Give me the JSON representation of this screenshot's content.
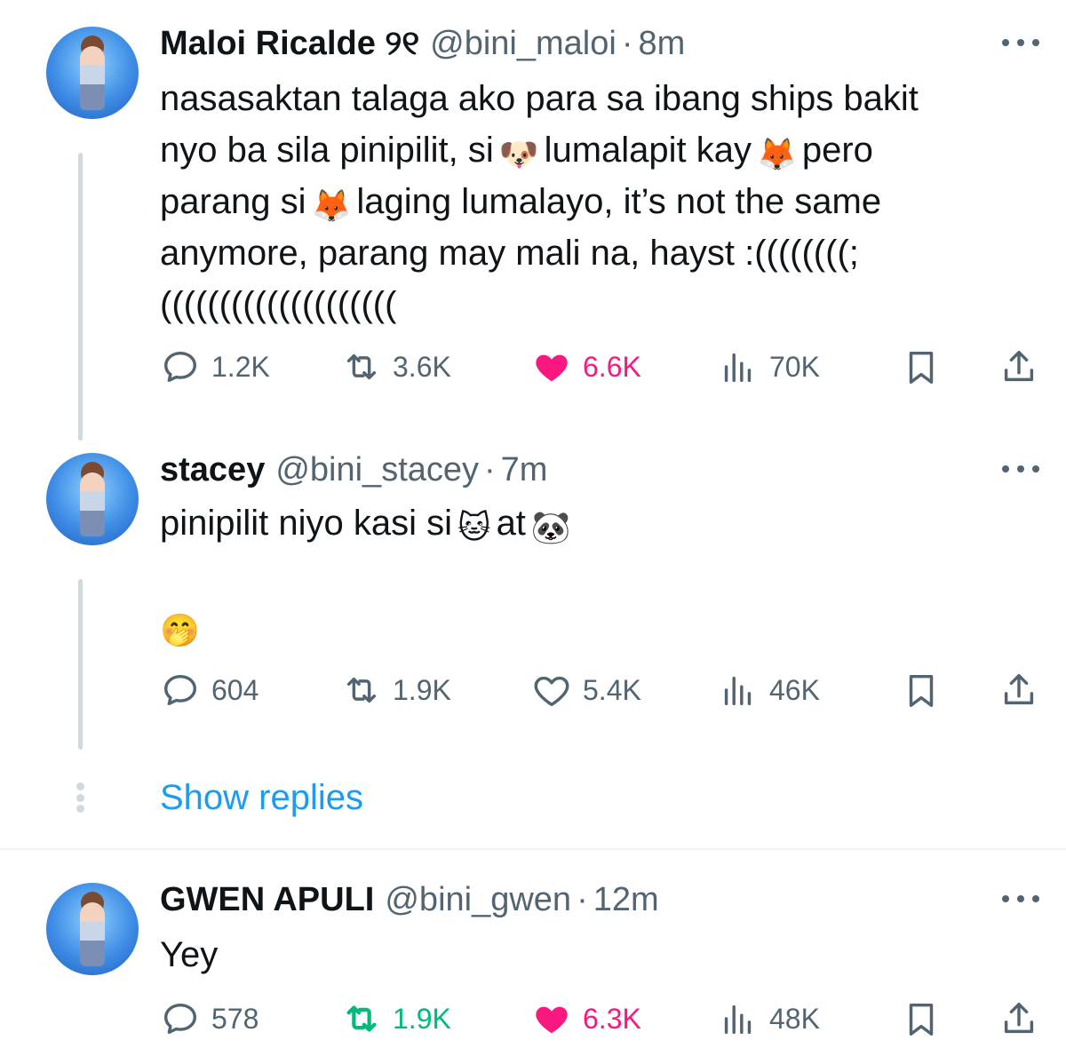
{
  "tweets": [
    {
      "name": "Maloi Ricalde",
      "name_suffix": "୨୧",
      "handle": "@bini_maloi",
      "time": "8m",
      "text_lines": [
        [
          "nasasaktan talaga ako para sa ibang ships bakit"
        ],
        [
          "nyo ba sila pinipilit, si",
          "🐶",
          "lumalapit kay",
          "🦊",
          "pero"
        ],
        [
          "parang si",
          "🦊",
          "laging lumalayo, it’s not the same"
        ],
        [
          "anymore, parang may mali na, hayst :((((((((;"
        ],
        [
          "(((((((((((((((((((("
        ]
      ],
      "replies": "1.2K",
      "reposts": "3.6K",
      "likes": "6.6K",
      "views": "70K",
      "liked": true,
      "reposted": false
    },
    {
      "name": "stacey",
      "handle": "@bini_stacey",
      "time": "7m",
      "text_line1_a": "pinipilit niyo kasi si",
      "emoji_cat": "🐱",
      "text_line1_b": "at",
      "emoji_panda": "🐼",
      "emoji_line2": "🤭",
      "replies": "604",
      "reposts": "1.9K",
      "likes": "5.4K",
      "views": "46K",
      "liked": false,
      "reposted": false
    },
    {
      "name": "GWEN APULI",
      "handle": "@bini_gwen",
      "time": "12m",
      "text": "Yey",
      "replies": "578",
      "reposts": "1.9K",
      "likes": "6.3K",
      "views": "48K",
      "liked": true,
      "reposted": true
    }
  ],
  "show_replies": "Show replies",
  "colors": {
    "like_active": "#f91880",
    "repost_active": "#00ba7c",
    "muted": "#536471",
    "link": "#1d9bf0",
    "thread_line": "#cfd9de"
  },
  "icons": [
    "reply-icon",
    "repost-icon",
    "heart-icon",
    "views-icon",
    "bookmark-icon",
    "share-icon",
    "more-icon"
  ]
}
